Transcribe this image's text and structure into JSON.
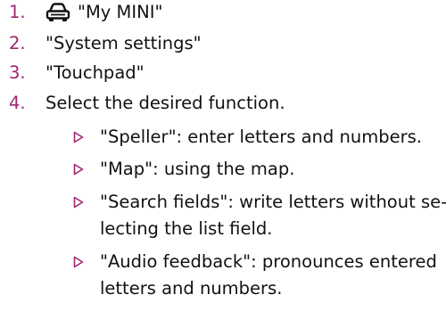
{
  "colors": {
    "step_number": "#a0266e",
    "bullet": "#a0266e",
    "text": "#111111"
  },
  "steps": [
    {
      "number": "1.",
      "icon": "car-icon",
      "text": "\"My MINI\""
    },
    {
      "number": "2.",
      "text": "\"System settings\""
    },
    {
      "number": "3.",
      "text": "\"Touchpad\""
    },
    {
      "number": "4.",
      "text": "Select the desired function."
    }
  ],
  "bullets": [
    {
      "lines": [
        "\"Speller\": enter letters and numbers."
      ]
    },
    {
      "lines": [
        "\"Map\": using the map."
      ]
    },
    {
      "lines": [
        "\"Search fields\": write letters without se-",
        "lecting the list field."
      ]
    },
    {
      "lines": [
        "\"Audio feedback\": pronounces entered",
        "letters and numbers."
      ]
    }
  ]
}
